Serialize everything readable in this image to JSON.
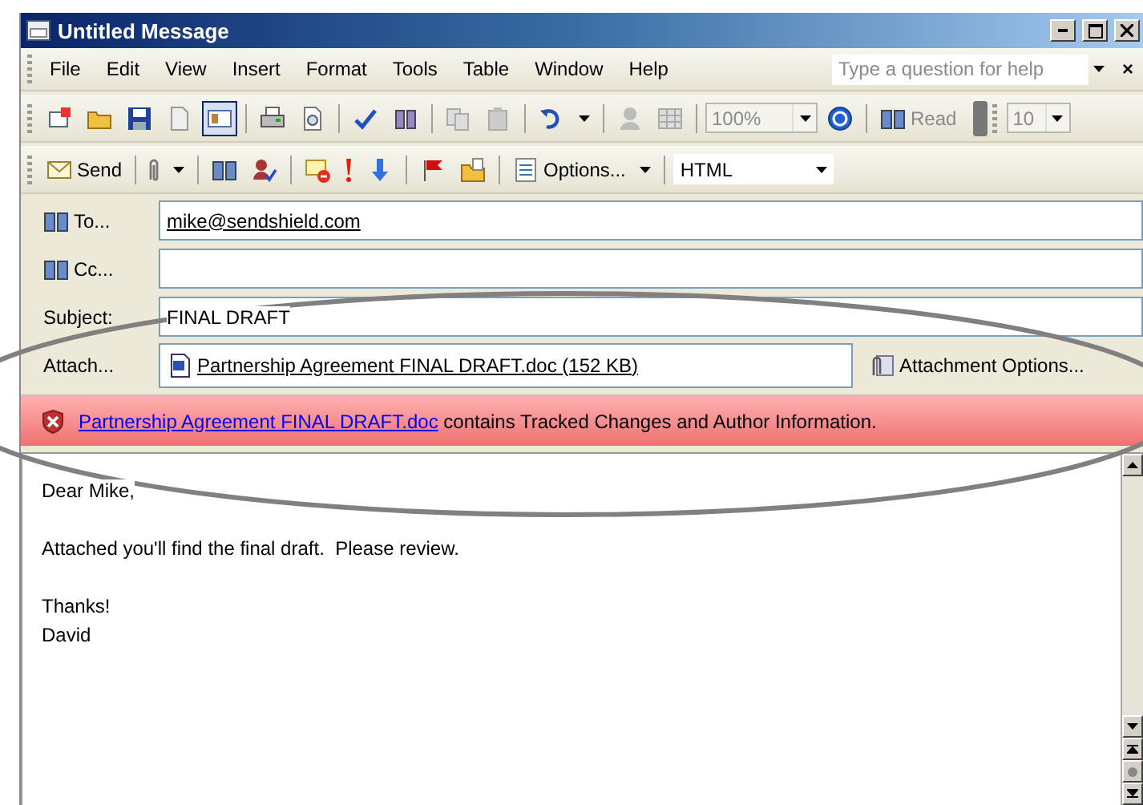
{
  "window": {
    "title": "Untitled Message"
  },
  "menu": {
    "items": [
      {
        "label": "File"
      },
      {
        "label": "Edit"
      },
      {
        "label": "View"
      },
      {
        "label": "Insert"
      },
      {
        "label": "Format"
      },
      {
        "label": "Tools"
      },
      {
        "label": "Table"
      },
      {
        "label": "Window"
      },
      {
        "label": "Help"
      }
    ],
    "help_placeholder": "Type a question for help",
    "help_close": "×"
  },
  "standard_toolbar": {
    "zoom": {
      "value": "100%",
      "disabled": true
    },
    "read": {
      "label": "Read",
      "disabled": true
    },
    "font_size": {
      "value": "10",
      "disabled": true
    }
  },
  "message_toolbar": {
    "send": "Send",
    "options": "Options...",
    "format": "HTML"
  },
  "header": {
    "to": {
      "label": "To...",
      "value": "mike@sendshield.com"
    },
    "cc": {
      "label": "Cc..."
    },
    "subject": {
      "label": "Subject:",
      "value": "FINAL DRAFT"
    },
    "attach": {
      "label": "Attach...",
      "file": "Partnership Agreement FINAL DRAFT.doc (152 KB)"
    },
    "attachment_options": "Attachment Options..."
  },
  "warning": {
    "link": "Partnership Agreement FINAL DRAFT.doc",
    "text": "contains Tracked Changes and Author Information."
  },
  "body": {
    "paragraphs": [
      {
        "lines": [
          "Dear Mike,"
        ]
      },
      {
        "lines": [
          "Attached you'll find the final draft.  Please review."
        ]
      },
      {
        "lines": [
          "Thanks!",
          "David"
        ]
      }
    ]
  }
}
